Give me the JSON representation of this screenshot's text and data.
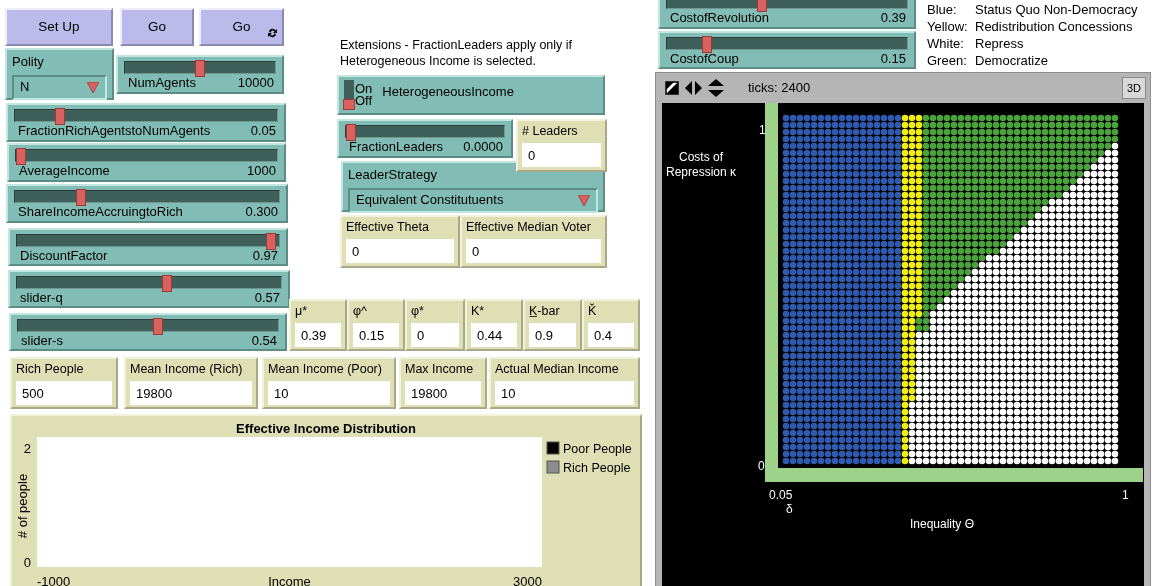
{
  "buttons": [
    {
      "label": "Set Up",
      "forever": false
    },
    {
      "label": "Go",
      "forever": false
    },
    {
      "label": "Go",
      "forever": true
    }
  ],
  "choosers": [
    {
      "label": "Polity",
      "value": "N"
    },
    {
      "label": "LeaderStrategy",
      "value": "Equivalent Constitutuents"
    }
  ],
  "sliders": [
    {
      "label": "NumAgents",
      "reading": "10000",
      "level": 0.5
    },
    {
      "label": "FractionRichAgentstoNumAgents",
      "reading": "0.05",
      "level": 0.16
    },
    {
      "label": "AverageIncome",
      "reading": "1000",
      "level": 0.0
    },
    {
      "label": "ShareIncomeAccruingtoRich",
      "reading": "0.300",
      "level": 0.24
    },
    {
      "label": "DiscountFactor",
      "reading": "0.97",
      "level": 0.99
    },
    {
      "label": "slider-q",
      "reading": "0.57",
      "level": 0.57
    },
    {
      "label": "slider-s",
      "reading": "0.54",
      "level": 0.54
    },
    {
      "label": "FractionLeaders",
      "reading": "0.0000",
      "level": 0.0
    },
    {
      "label": "CostofRevolution",
      "reading": "0.39",
      "level": 0.39
    },
    {
      "label": "CostofCoup",
      "reading": "0.15",
      "level": 0.15
    }
  ],
  "note": "Extensions - FractionLeaders apply only if Heterogeneous Income is selected.",
  "switch": {
    "label": "HeterogeneousIncome",
    "on_text": "On",
    "off_text": "Off",
    "on": false
  },
  "monitors": [
    {
      "label": "# Leaders",
      "value": "0"
    },
    {
      "label": "Effective Theta",
      "value": "0"
    },
    {
      "label": "Effective Median Voter",
      "value": "0"
    },
    {
      "label": "μ*",
      "value": "0.39"
    },
    {
      "label": "φ^",
      "value": "0.15"
    },
    {
      "label": "φ*",
      "value": "0"
    },
    {
      "label": "K*",
      "value": "0.44"
    },
    {
      "label": "K̲-bar",
      "value": "0.9"
    },
    {
      "label": "Ǩ",
      "value": "0.4"
    },
    {
      "label": "Rich People",
      "value": "500"
    },
    {
      "label": "Mean Income (Rich)",
      "value": "19800"
    },
    {
      "label": "Mean Income (Poor)",
      "value": "10"
    },
    {
      "label": "Max Income",
      "value": "19800"
    },
    {
      "label": "Actual Median Income",
      "value": "10"
    }
  ],
  "legend": [
    {
      "key": "Blue:",
      "text": "Status Quo Non-Democracy"
    },
    {
      "key": "Yellow:",
      "text": "Redistribution Concessions"
    },
    {
      "key": "White:",
      "text": "Repress"
    },
    {
      "key": "Green:",
      "text": "Democratize"
    }
  ],
  "view": {
    "ticks": "ticks: 2400",
    "button_3d": "3D",
    "labels": [
      "Costs of Repression κ",
      "1",
      "0",
      "0.05",
      "δ",
      "1",
      "Inequality Θ"
    ]
  },
  "plot": {
    "title": "Effective Income Distribution",
    "y_axis": {
      "label": "# of people",
      "max": "2",
      "min": "0"
    },
    "x_axis": {
      "label": "Income",
      "min": "-1000",
      "max": "3000"
    },
    "pens": [
      {
        "name": "Poor People",
        "color": "#000000"
      },
      {
        "name": "Rich People",
        "color": "#8c8c8c"
      }
    ]
  }
}
